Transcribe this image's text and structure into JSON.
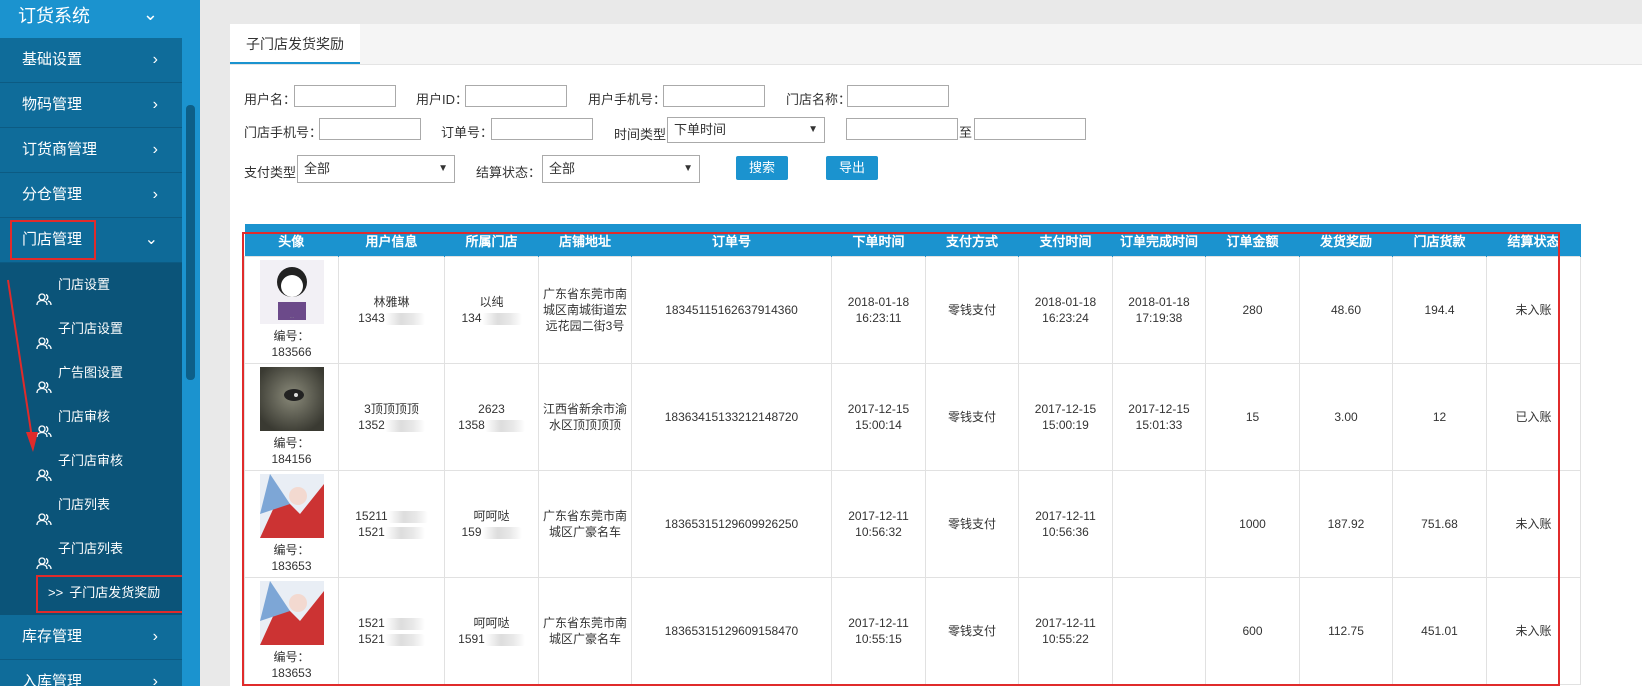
{
  "sidebar": {
    "system_title": "订货系统",
    "items": [
      {
        "label": "基础设置"
      },
      {
        "label": "物码管理"
      },
      {
        "label": "订货商管理"
      },
      {
        "label": "分仓管理"
      },
      {
        "label": "门店管理"
      }
    ],
    "sub_items": [
      {
        "label": "门店设置"
      },
      {
        "label": "子门店设置"
      },
      {
        "label": "广告图设置"
      },
      {
        "label": "门店审核"
      },
      {
        "label": "子门店审核"
      },
      {
        "label": "门店列表"
      },
      {
        "label": "子门店列表"
      },
      {
        "label": "子门店发货奖励"
      }
    ],
    "bottom_items": [
      {
        "label": "库存管理"
      },
      {
        "label": "入库管理"
      }
    ]
  },
  "tab": {
    "label": "子门店发货奖励"
  },
  "filters": {
    "username_label": "用户名：",
    "userid_label": "用户ID：",
    "userphone_label": "用户手机号：",
    "storename_label": "门店名称：",
    "storephone_label": "门店手机号：",
    "orderno_label": "订单号：",
    "timetype_label": "时间类型",
    "timetype_value": "下单时间",
    "to_label": "至",
    "paytype_label": "支付类型",
    "paytype_value": "全部",
    "settle_label": "结算状态：",
    "settle_value": "全部",
    "search_button": "搜索",
    "export_button": "导出"
  },
  "table": {
    "headers": [
      "头像",
      "用户信息",
      "所属门店",
      "店铺地址",
      "订单号",
      "下单时间",
      "支付方式",
      "支付时间",
      "订单完成时间",
      "订单金额",
      "发货奖励",
      "门店货款",
      "结算状态"
    ],
    "rows": [
      {
        "id_label": "编号：",
        "id": "183566",
        "user_name": "林雅琳",
        "user_phone": "1343",
        "store_name": "以纯",
        "store_phone": "134",
        "address": "广东省东莞市南城区南城街道宏远花园二街3号",
        "order_no": "18345115162637914360",
        "order_time": "2018-01-18 16:23:11",
        "pay_method": "零钱支付",
        "pay_time": "2018-01-18 16:23:24",
        "done_time": "2018-01-18 17:19:38",
        "amount": "280",
        "reward": "48.60",
        "payment": "194.4",
        "status": "未入账"
      },
      {
        "id_label": "编号：",
        "id": "184156",
        "user_name": "3顶顶顶顶",
        "user_phone": "1352",
        "store_name": "2623",
        "store_phone": "1358",
        "address": "江西省新余市渝水区顶顶顶顶",
        "order_no": "18363415133212148720",
        "order_time": "2017-12-15 15:00:14",
        "pay_method": "零钱支付",
        "pay_time": "2017-12-15 15:00:19",
        "done_time": "2017-12-15 15:01:33",
        "amount": "15",
        "reward": "3.00",
        "payment": "12",
        "status": "已入账"
      },
      {
        "id_label": "编号：",
        "id": "183653",
        "user_name": "15211",
        "user_phone": "1521",
        "store_name": "呵呵哒",
        "store_phone": "159",
        "address": "广东省东莞市南城区广豪名车",
        "order_no": "18365315129609926250",
        "order_time": "2017-12-11 10:56:32",
        "pay_method": "零钱支付",
        "pay_time": "2017-12-11 10:56:36",
        "done_time": "",
        "amount": "1000",
        "reward": "187.92",
        "payment": "751.68",
        "status": "未入账"
      },
      {
        "id_label": "编号：",
        "id": "183653",
        "user_name": "1521",
        "user_phone": "1521",
        "store_name": "呵呵哒",
        "store_phone": "1591",
        "address": "广东省东莞市南城区广豪名车",
        "order_no": "18365315129609158470",
        "order_time": "2017-12-11 10:55:15",
        "pay_method": "零钱支付",
        "pay_time": "2017-12-11 10:55:22",
        "done_time": "",
        "amount": "600",
        "reward": "112.75",
        "payment": "451.01",
        "status": "未入账"
      }
    ]
  },
  "colors": {
    "accent": "#1b93cf",
    "sidebar": "#0f6c9a",
    "highlight": "#e02b2b"
  }
}
